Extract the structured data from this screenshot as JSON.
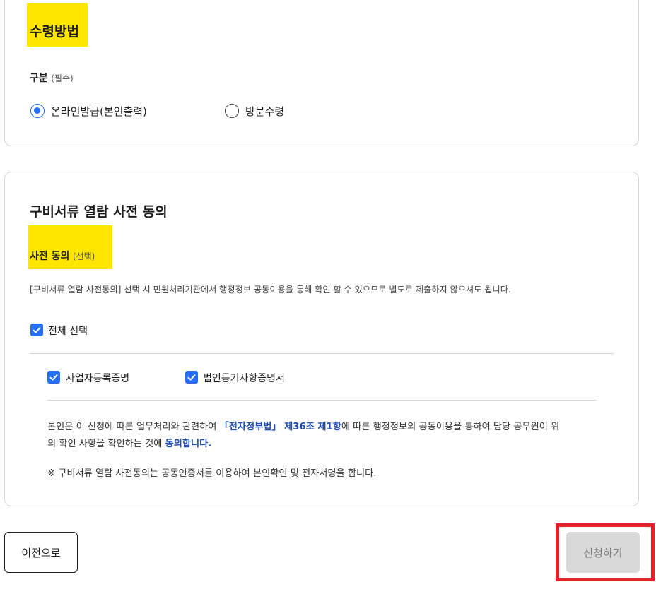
{
  "receipt": {
    "title": "수령방법",
    "category_label": "구분",
    "category_note": "(필수)",
    "options": [
      {
        "label": "온라인발급(본인출력)",
        "selected": true
      },
      {
        "label": "방문수령",
        "selected": false
      }
    ]
  },
  "consent": {
    "title": "구비서류 열람 사전 동의",
    "subtitle": "사전 동의",
    "subtitle_note": "(선택)",
    "description": "[구비서류 열람 사전동의] 선택 시 민원처리기관에서 행정정보 공동이용을 통해 확인 할 수 있으므로 별도로 제출하지 않으셔도 됩니다.",
    "select_all_label": "전체 선택",
    "items": [
      {
        "label": "사업자등록증명",
        "checked": true
      },
      {
        "label": "법인등기사항증명서",
        "checked": true
      }
    ],
    "agreement": {
      "prefix": "본인은 이 신청에 따른 업무처리와 관련하여 ",
      "law": "「전자정부법」 제36조 제1항",
      "middle1": "에 따른 행정정보의 공동이용을 통하여 담당 공무원이 위",
      "middle2": "의 확인 사항을 확인하는 것에 ",
      "agree": "동의합니다."
    },
    "notice": "※ 구비서류 열람 사전동의는 공동인증서를 이용하여 본인확인 및 전자서명을 합니다."
  },
  "buttons": {
    "prev": "이전으로",
    "apply": "신청하기"
  },
  "colors": {
    "highlight": "#ffe600",
    "accent": "#256ef4",
    "law_text": "#1f4fb5",
    "focus_frame": "#e5222a",
    "disabled_button": "#d9d9d9"
  }
}
